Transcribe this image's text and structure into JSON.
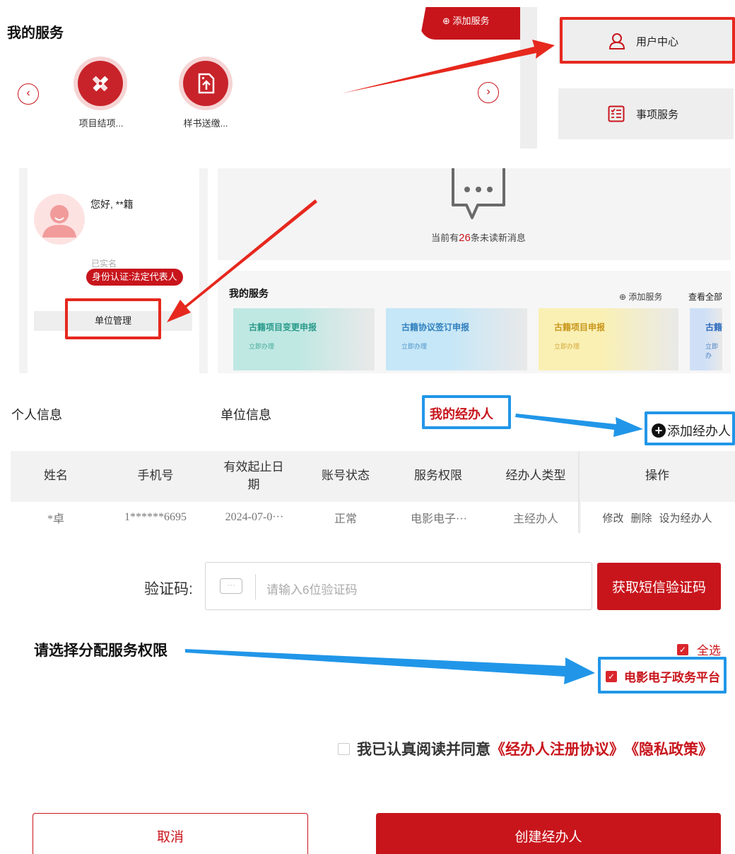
{
  "section1": {
    "title": "我的服务",
    "add_service": "⊕ 添加服务",
    "services": [
      {
        "label": "项目结项...",
        "icon": "pen-ruler-icon"
      },
      {
        "label": "样书送缴...",
        "icon": "upload-icon"
      }
    ],
    "side_cards": [
      {
        "label": "用户中心",
        "icon": "user-icon"
      },
      {
        "label": "事项服务",
        "icon": "checklist-icon"
      }
    ]
  },
  "section2": {
    "greeting": "您好, **籍",
    "verified": "已实名",
    "badge": "身份认证:法定代表人",
    "unit_manage": "单位管理",
    "msg_prefix": "当前有",
    "msg_count": "26",
    "msg_suffix": "条未读新消息",
    "services_title": "我的服务",
    "add_service": "⊕ 添加服务",
    "view_all": "查看全部",
    "cards": [
      {
        "title": "古籍项目变更申报",
        "sub": "立即办理",
        "color": "#bfe8e3",
        "text_color": "#2a9a8a"
      },
      {
        "title": "古籍协议签订申报",
        "sub": "立即办理",
        "color": "#c6e7f7",
        "text_color": "#2f7fbd"
      },
      {
        "title": "古籍项目申报",
        "sub": "立即办理",
        "color": "#faf0b4",
        "text_color": "#c9961c"
      },
      {
        "title": "古籍",
        "sub": "立即办",
        "color": "#cfe0f6",
        "text_color": "#2f6bbd"
      }
    ]
  },
  "section3": {
    "tabs": [
      "个人信息",
      "单位信息",
      "我的经办人"
    ],
    "add_agent": "添加经办人",
    "headers": [
      "姓名",
      "手机号",
      "有效起止日期",
      "账号状态",
      "服务权限",
      "经办人类型",
      "操作"
    ],
    "row": {
      "name": "*卓",
      "phone": "1******6695",
      "date": "2024-07-0···",
      "status": "正常",
      "permission": "电影电子···",
      "type": "主经办人",
      "actions": [
        "修改",
        "删除",
        "设为经办人"
      ]
    }
  },
  "section4": {
    "code_label": "验证码:",
    "code_placeholder": "请输入6位验证码",
    "sms_button": "获取短信验证码",
    "perm_title": "请选择分配服务权限",
    "select_all": "全选",
    "platform": "电影电子政务平台",
    "agree_prefix": "我已认真阅读并同意",
    "agreement1": "《经办人注册协议》",
    "agreement2": "《隐私政策》",
    "cancel": "取消",
    "create": "创建经办人"
  },
  "colors": {
    "brand_red": "#c8151c",
    "annotation_red": "#e6281e",
    "annotation_blue": "#2196e8"
  }
}
